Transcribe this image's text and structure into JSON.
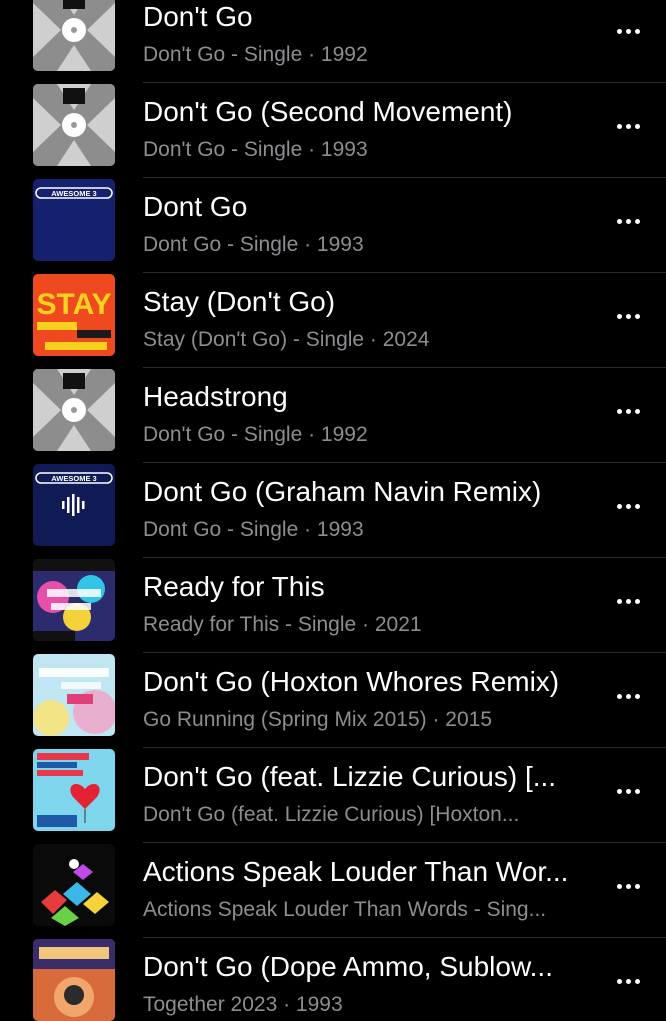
{
  "songs": [
    {
      "title": "Don't Go",
      "subtitle": "Don't Go - Single · 1992",
      "art_icon": "xl-vinyl-sleeve-art"
    },
    {
      "title": "Don't Go (Second Movement)",
      "subtitle": "Don't Go - Single · 1993",
      "art_icon": "xl-vinyl-sleeve-art"
    },
    {
      "title": "Dont Go",
      "subtitle": "Dont Go - Single · 1993",
      "art_icon": "awesome3-navy-art",
      "art_label": "AWESOME 3"
    },
    {
      "title": "Stay (Don't Go)",
      "subtitle": "Stay (Don't Go) - Single · 2024",
      "art_icon": "stay-orange-art",
      "art_label": "STAY"
    },
    {
      "title": "Headstrong",
      "subtitle": "Don't Go - Single · 1992",
      "art_icon": "xl-vinyl-sleeve-art"
    },
    {
      "title": "Dont Go (Graham Navin Remix)",
      "subtitle": "Dont Go - Single · 1993",
      "art_icon": "awesome3-navy-waveform-art",
      "art_label": "AWESOME 3"
    },
    {
      "title": "Ready for This",
      "subtitle": "Ready for This - Single · 2021",
      "art_icon": "ready-for-this-art"
    },
    {
      "title": "Don't Go (Hoxton Whores Remix)",
      "subtitle": "Go Running (Spring Mix 2015) · 2015",
      "art_icon": "go-running-art"
    },
    {
      "title": "Don't Go (feat. Lizzie Curious) [...",
      "subtitle": "Don't Go (feat. Lizzie Curious) [Hoxton...",
      "art_icon": "heart-balloon-art"
    },
    {
      "title": "Actions Speak Louder Than Wor...",
      "subtitle": "Actions Speak Louder Than Words - Sing...",
      "art_icon": "colorful-blocks-art"
    },
    {
      "title": "Don't Go (Dope Ammo, Sublow...",
      "subtitle": "Together 2023 · 1993",
      "art_icon": "together-art"
    }
  ],
  "more_icon": "ellipsis-icon",
  "colors": {
    "background": "#000000",
    "title": "#ffffff",
    "subtitle": "#8d8d92",
    "separator": "#2a2a2c"
  }
}
